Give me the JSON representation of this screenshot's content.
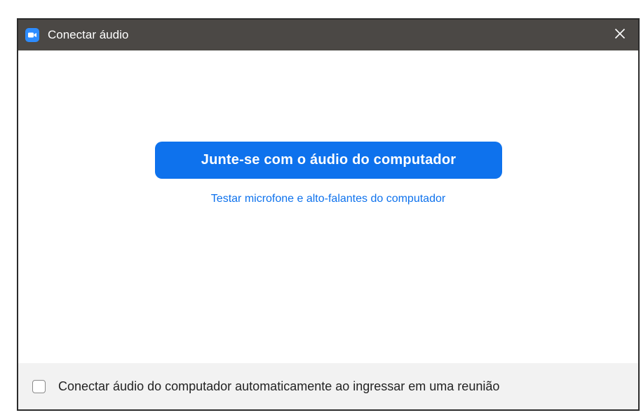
{
  "window": {
    "title": "Conectar áudio",
    "icon": "zoom-camera-icon",
    "close_icon": "close-icon"
  },
  "main": {
    "join_button_label": "Junte-se com o áudio do computador",
    "test_link_label": "Testar microfone e alto-falantes do computador"
  },
  "footer": {
    "auto_connect_label": "Conectar áudio do computador automaticamente ao ingressar em uma reunião",
    "auto_connect_checked": false
  },
  "colors": {
    "titlebar": "#4b4845",
    "accent": "#0e72ed",
    "footer_bg": "#f2f2f2"
  }
}
